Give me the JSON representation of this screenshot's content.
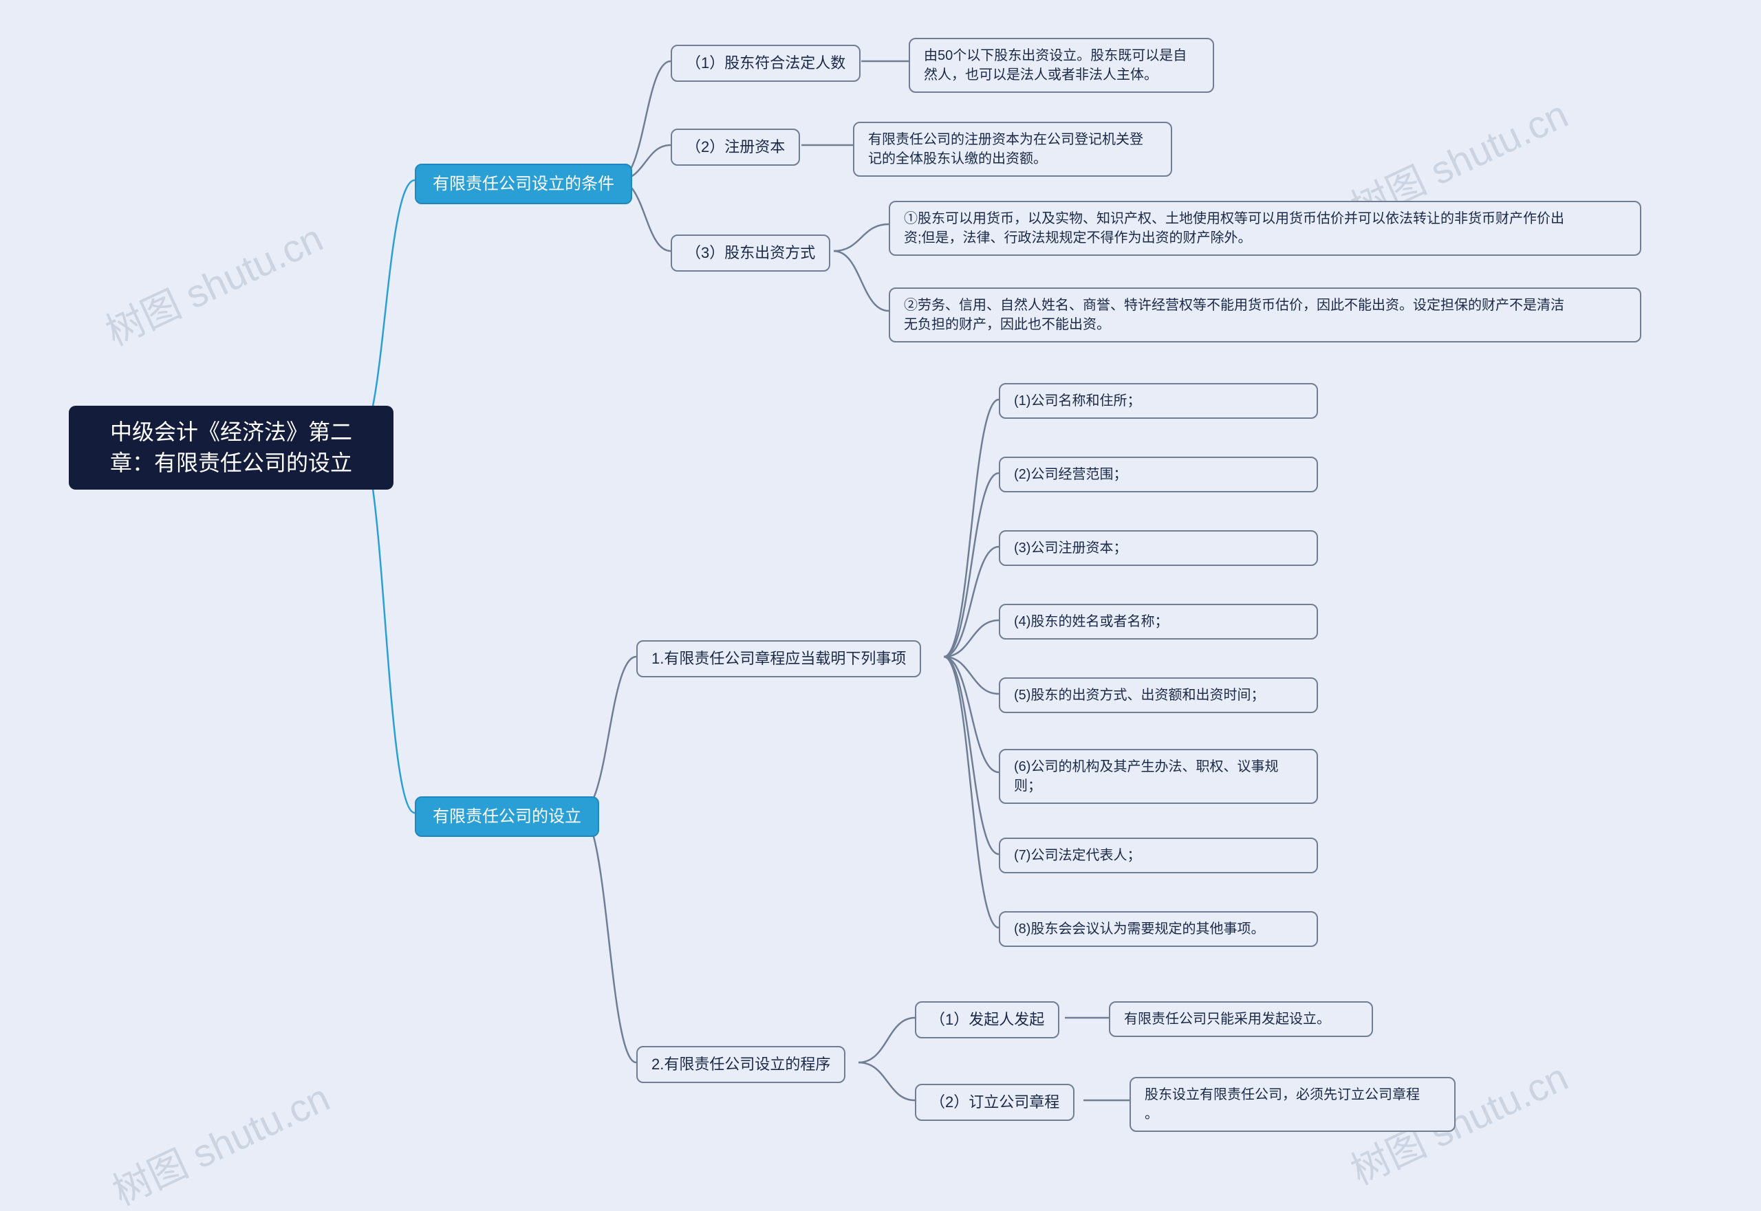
{
  "watermarks": {
    "top_left": "树图 shutu.cn",
    "top_right": "树图 shutu.cn",
    "bottom_left": "树图 shutu.cn",
    "bottom_right": "树图 shutu.cn"
  },
  "root": {
    "title": "中级会计《经济法》第二\n章：有限责任公司的设立"
  },
  "l1": {
    "a": {
      "label": "有限责任公司设立的条件"
    },
    "b": {
      "label": "有限责任公司的设立"
    }
  },
  "l2": {
    "a1": {
      "label": "（1）股东符合法定人数"
    },
    "a2": {
      "label": "（2）注册资本"
    },
    "a3": {
      "label": "（3）股东出资方式"
    },
    "b1": {
      "label": "1.有限责任公司章程应当载明下列事项"
    },
    "b2": {
      "label": "2.有限责任公司设立的程序"
    }
  },
  "l3": {
    "a1_1": {
      "text": "由50个以下股东出资设立。股东既可以是自\n然人，也可以是法人或者非法人主体。"
    },
    "a2_1": {
      "text": "有限责任公司的注册资本为在公司登记机关登\n记的全体股东认缴的出资额。"
    },
    "a3_1": {
      "text": "①股东可以用货币，以及实物、知识产权、土地使用权等可以用货币估价并可以依法转让的非货币财产作价出\n资;但是，法律、行政法规规定不得作为出资的财产除外。"
    },
    "a3_2": {
      "text": "②劳务、信用、自然人姓名、商誉、特许经营权等不能用货币估价，因此不能出资。设定担保的财产不是清洁\n无负担的财产，因此也不能出资。"
    },
    "b1_1": {
      "text": "(1)公司名称和住所；"
    },
    "b1_2": {
      "text": "(2)公司经营范围；"
    },
    "b1_3": {
      "text": "(3)公司注册资本；"
    },
    "b1_4": {
      "text": "(4)股东的姓名或者名称；"
    },
    "b1_5": {
      "text": "(5)股东的出资方式、出资额和出资时间；"
    },
    "b1_6": {
      "text": "(6)公司的机构及其产生办法、职权、议事规\n则；"
    },
    "b1_7": {
      "text": "(7)公司法定代表人；"
    },
    "b1_8": {
      "text": "(8)股东会会议认为需要规定的其他事项。"
    },
    "b2_1": {
      "label": "（1）发起人发起",
      "text": "有限责任公司只能采用发起设立。"
    },
    "b2_2": {
      "label": "（2）订立公司章程",
      "text": "股东设立有限责任公司，必须先订立公司章程\n。"
    }
  }
}
